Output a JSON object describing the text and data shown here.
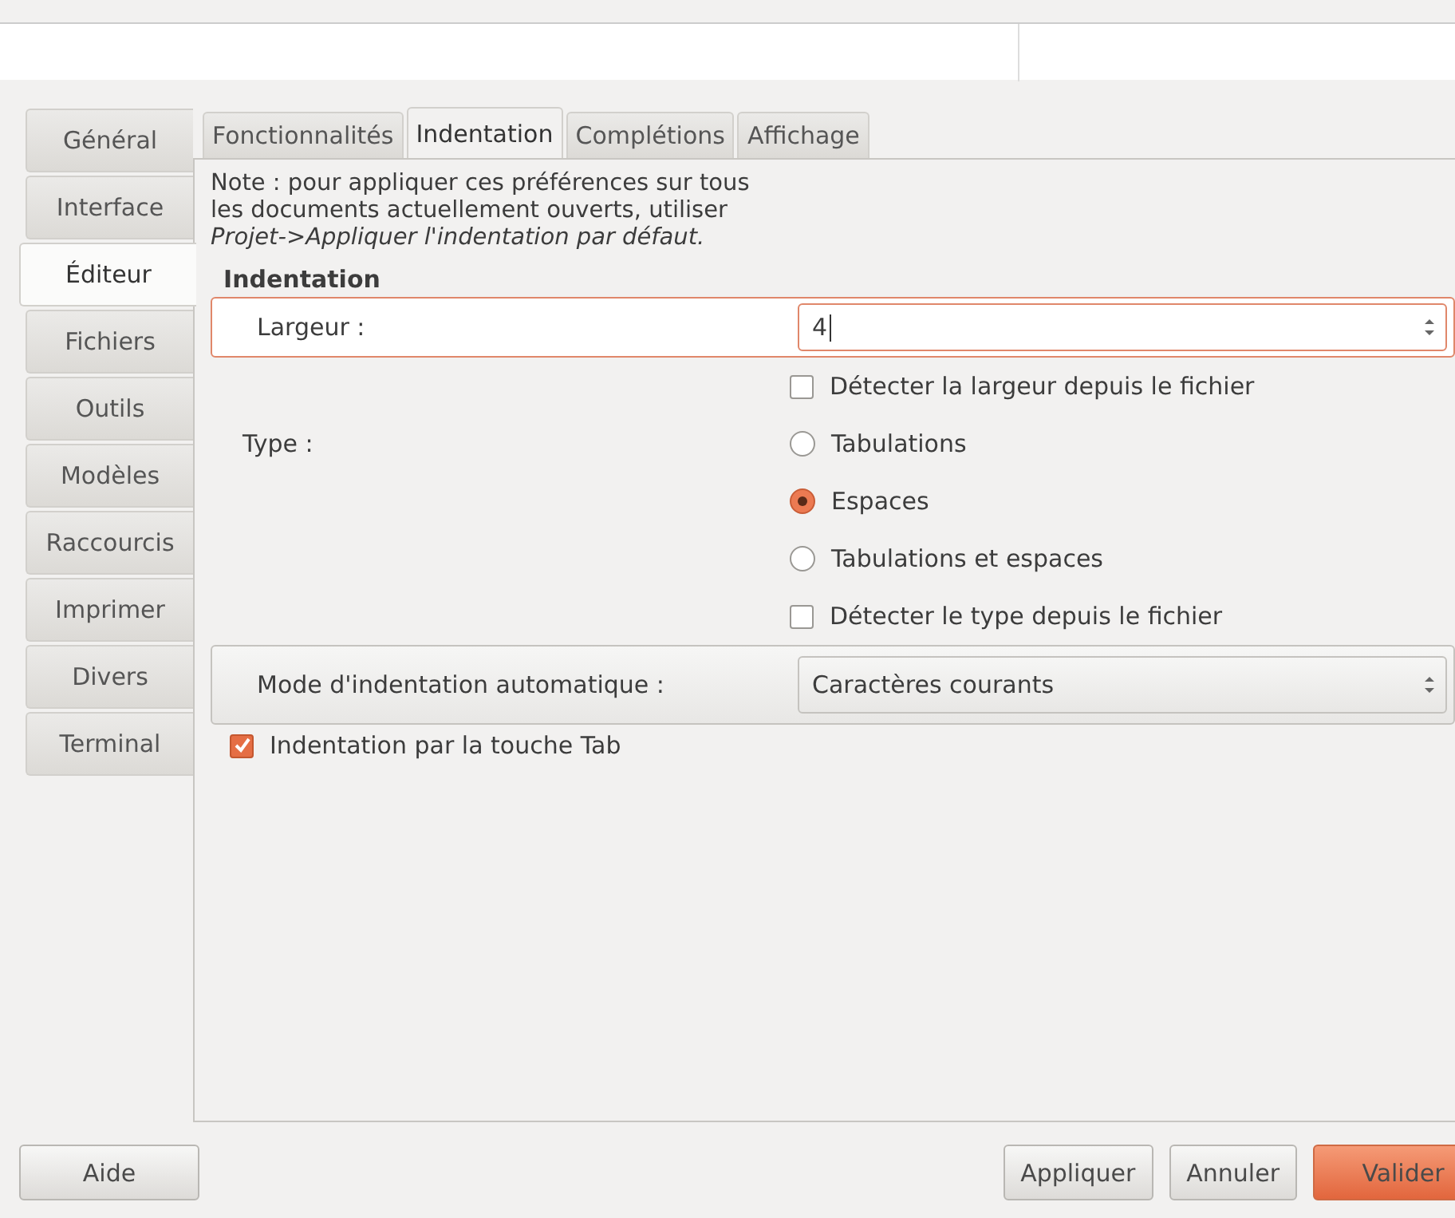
{
  "sidebar_tabs": [
    {
      "label": "Général",
      "selected": false
    },
    {
      "label": "Interface",
      "selected": false
    },
    {
      "label": "Éditeur",
      "selected": true
    },
    {
      "label": "Fichiers",
      "selected": false
    },
    {
      "label": "Outils",
      "selected": false
    },
    {
      "label": "Modèles",
      "selected": false
    },
    {
      "label": "Raccourcis",
      "selected": false
    },
    {
      "label": "Imprimer",
      "selected": false
    },
    {
      "label": "Divers",
      "selected": false
    },
    {
      "label": "Terminal",
      "selected": false
    }
  ],
  "tabs": [
    {
      "label": "Fonctionnalités",
      "selected": false
    },
    {
      "label": "Indentation",
      "selected": true
    },
    {
      "label": "Complétions",
      "selected": false
    },
    {
      "label": "Affichage",
      "selected": false
    }
  ],
  "note": {
    "lines": [
      "Note : pour appliquer ces préférences sur tous",
      "les documents actuellement ouverts, utiliser"
    ],
    "action": "Projet->Appliquer l'indentation par défaut."
  },
  "section_title": "Indentation",
  "rows": [
    {
      "label": "Largeur :",
      "control": {
        "kind": "spin",
        "value": "4"
      }
    },
    {
      "control": {
        "kind": "checkbox",
        "text": "Détecter la largeur depuis le fichier",
        "checked": false
      }
    },
    {
      "label": "Type :",
      "control": {
        "kind": "radio",
        "text": "Tabulations",
        "selected": false
      }
    },
    {
      "control": {
        "kind": "radio",
        "text": "Espaces",
        "selected": true
      }
    },
    {
      "control": {
        "kind": "radio",
        "text": "Tabulations et espaces",
        "selected": false
      }
    },
    {
      "control": {
        "kind": "checkbox",
        "text": "Détecter le type depuis le fichier",
        "checked": false
      }
    },
    {
      "label": "Mode d'indentation automatique :",
      "control": {
        "kind": "combo",
        "value": "Caractères courants"
      }
    }
  ],
  "tab_key": {
    "text": "Indentation par la touche Tab",
    "checked": true
  },
  "help_button": "Aide",
  "buttons": [
    {
      "label": "Appliquer",
      "kind": "normal"
    },
    {
      "label": "Annuler",
      "kind": "normal"
    },
    {
      "label": "Valider",
      "kind": "suggested"
    }
  ]
}
